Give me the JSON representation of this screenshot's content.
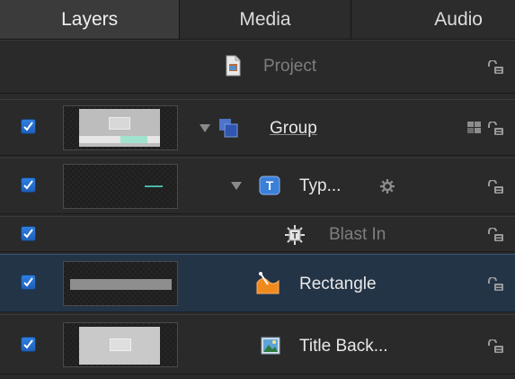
{
  "tabs": [
    {
      "label": "Layers",
      "active": true
    },
    {
      "label": "Media",
      "active": false
    },
    {
      "label": "Audio",
      "active": false
    }
  ],
  "rows": [
    {
      "label": "Project",
      "checked": false,
      "dim": true,
      "icon": "project-icon"
    },
    {
      "label": "Group",
      "checked": true,
      "dim": false,
      "icon": "group-icon"
    },
    {
      "label": "Typ...",
      "checked": true,
      "dim": false,
      "icon": "text-icon"
    },
    {
      "label": "Blast In",
      "checked": true,
      "dim": true,
      "icon": "behavior-icon"
    },
    {
      "label": "Rectangle",
      "checked": true,
      "dim": false,
      "icon": "shape-icon",
      "selected": true
    },
    {
      "label": "Title Back...",
      "checked": true,
      "dim": false,
      "icon": "image-icon"
    }
  ],
  "colors": {
    "selected_row": "#243447",
    "checkbox": "#2f7fe0",
    "teal_accent": "#49b6a8"
  }
}
